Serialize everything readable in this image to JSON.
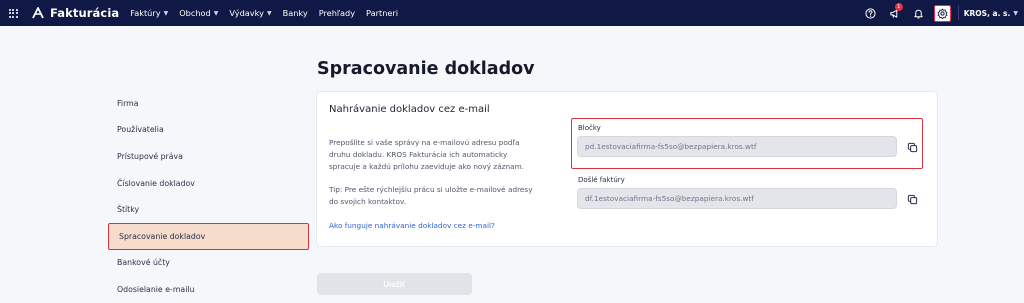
{
  "app": {
    "name": "Fakturácia"
  },
  "nav": [
    {
      "label": "Faktúry",
      "dropdown": true
    },
    {
      "label": "Obchod",
      "dropdown": true
    },
    {
      "label": "Výdavky",
      "dropdown": true
    },
    {
      "label": "Banky",
      "dropdown": false
    },
    {
      "label": "Prehľady",
      "dropdown": false
    },
    {
      "label": "Partneri",
      "dropdown": false
    }
  ],
  "topbar": {
    "icons": [
      "help-icon",
      "announcement-icon",
      "bell-icon",
      "gear-icon"
    ],
    "notification_count": "1",
    "company": "KROS, a. s."
  },
  "sidebar": {
    "items": [
      {
        "label": "Firma"
      },
      {
        "label": "Používatelia"
      },
      {
        "label": "Prístupové práva"
      },
      {
        "label": "Číslovanie dokladov"
      },
      {
        "label": "Štítky"
      },
      {
        "label": "Spracovanie dokladov"
      },
      {
        "label": "Bankové účty"
      },
      {
        "label": "Odosielanie e-mailu"
      }
    ],
    "active_index": 5
  },
  "main": {
    "title": "Spracovanie dokladov",
    "card": {
      "title": "Nahrávanie dokladov cez e-mail",
      "description": "Prepošlite si vaše správy na e-mailovú adresu podľa druhu dokladu. KROS Fakturácia ich automaticky spracuje a každú prílohu zaeviduje ako nový záznam.",
      "tip": "Tip: Pre ešte rýchlejšiu prácu si uložte e-mailové adresy do svojich kontaktov.",
      "help_link": "Ako funguje nahrávanie dokladov cez e-mail?",
      "fields": [
        {
          "label": "Bločky",
          "value": "pd.1estovaciafirma-fs5so@bezpapiera.kros.wtf"
        },
        {
          "label": "Došlé faktúry",
          "value": "df.1estovaciafirma-fs5so@bezpapiera.kros.wtf"
        }
      ]
    },
    "save_label": "Uložiť"
  },
  "colors": {
    "topbar_bg": "#101845",
    "highlight_red": "#d4343b",
    "link_blue": "#2f63d8",
    "active_item_bg": "#f6dccd",
    "badge_red": "#e2334a"
  }
}
